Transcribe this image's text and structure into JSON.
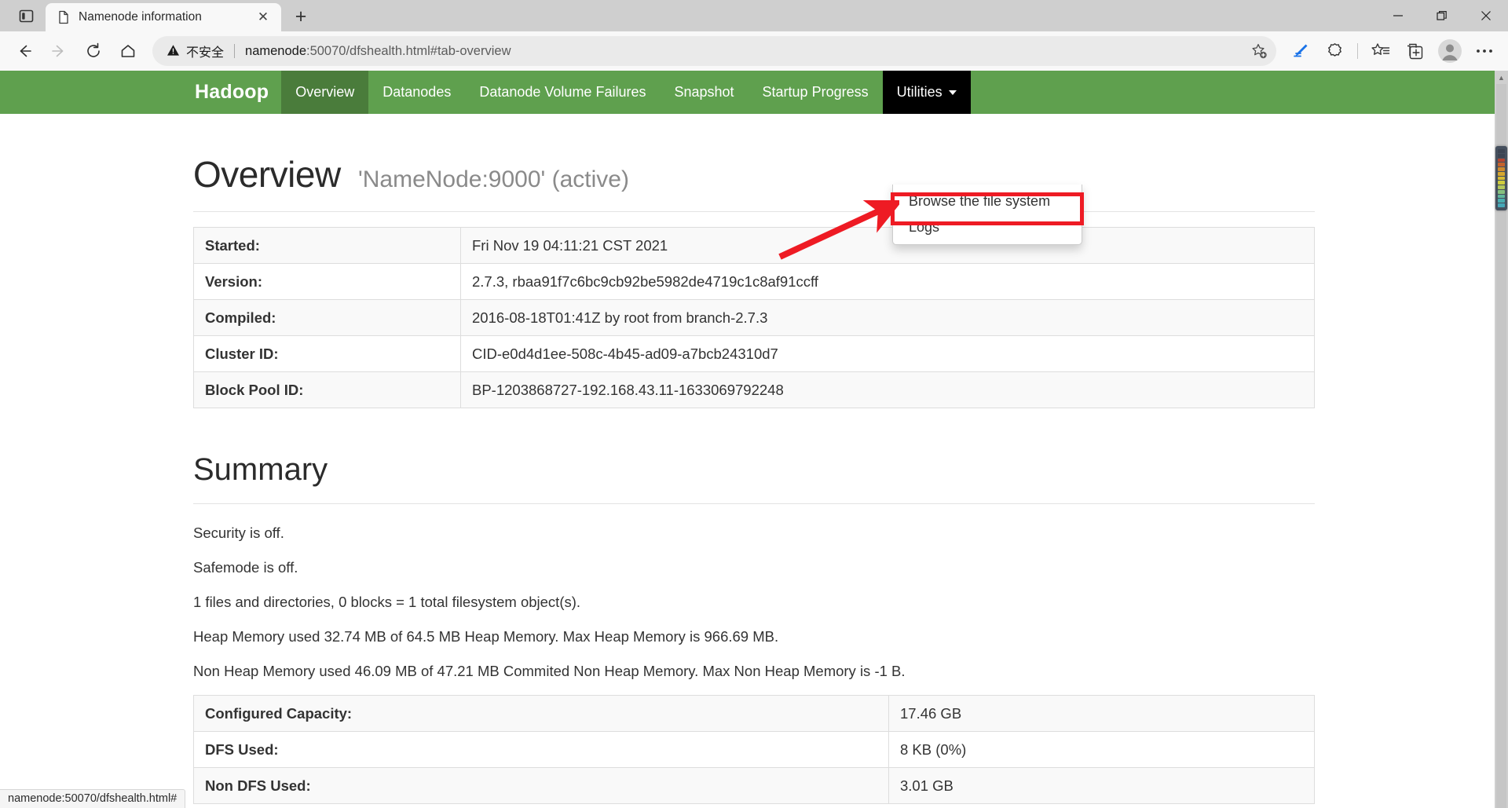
{
  "browser": {
    "tab": {
      "title": "Namenode information",
      "favicon_icon": "document-icon",
      "close_icon": "close-icon"
    },
    "tab_layout_icon": "tab-layout-icon",
    "new_tab_icon": "plus-icon",
    "window_controls": {
      "minimize": "minimize-icon",
      "maximize": "restore-icon",
      "close": "close-icon"
    },
    "nav": {
      "back_icon": "back-arrow-icon",
      "forward_icon": "forward-arrow-icon",
      "reload_icon": "reload-icon",
      "home_icon": "home-icon"
    },
    "omnibox": {
      "warning_icon": "warning-triangle-icon",
      "warning_text": "不安全",
      "url_host": "namenode",
      "url_rest": ":50070/dfshealth.html#tab-overview",
      "url_full": "namenode:50070/dfshealth.html#tab-overview",
      "star_icon": "add-favorite-icon"
    },
    "toolbar_icons": [
      {
        "name": "collections-pen-icon",
        "glyph": "✑"
      },
      {
        "name": "extensions-puzzle-icon",
        "glyph": "✿"
      },
      {
        "name": "favorites-star-list-icon",
        "glyph": "☆"
      },
      {
        "name": "split-screen-add-icon",
        "glyph": "⧉"
      },
      {
        "name": "profile-avatar-icon",
        "glyph": "●"
      },
      {
        "name": "settings-more-icon",
        "glyph": "⋯"
      }
    ]
  },
  "hadoop": {
    "brand": "Hadoop",
    "nav_items": [
      {
        "label": "Overview",
        "state": "active"
      },
      {
        "label": "Datanodes",
        "state": "normal"
      },
      {
        "label": "Datanode Volume Failures",
        "state": "normal"
      },
      {
        "label": "Snapshot",
        "state": "normal"
      },
      {
        "label": "Startup Progress",
        "state": "normal"
      },
      {
        "label": "Utilities",
        "state": "open",
        "caret": true
      }
    ],
    "dropdown": {
      "items": [
        {
          "label": "Browse the file system",
          "highlighted": true
        },
        {
          "label": "Logs",
          "highlighted": false
        }
      ],
      "highlight_color": "#ee1b24"
    },
    "overview": {
      "title": "Overview",
      "subtitle": "'NameNode:9000' (active)",
      "rows": [
        {
          "key": "Started:",
          "value": "Fri Nov 19 04:11:21 CST 2021"
        },
        {
          "key": "Version:",
          "value": "2.7.3, rbaa91f7c6bc9cb92be5982de4719c1c8af91ccff"
        },
        {
          "key": "Compiled:",
          "value": "2016-08-18T01:41Z by root from branch-2.7.3"
        },
        {
          "key": "Cluster ID:",
          "value": "CID-e0d4d1ee-508c-4b45-ad09-a7bcb24310d7"
        },
        {
          "key": "Block Pool ID:",
          "value": "BP-1203868727-192.168.43.11-1633069792248"
        }
      ]
    },
    "summary": {
      "title": "Summary",
      "lines": [
        "Security is off.",
        "Safemode is off.",
        "1 files and directories, 0 blocks = 1 total filesystem object(s).",
        "Heap Memory used 32.74 MB of 64.5 MB Heap Memory. Max Heap Memory is 966.69 MB.",
        "Non Heap Memory used 46.09 MB of 47.21 MB Commited Non Heap Memory. Max Non Heap Memory is -1 B."
      ],
      "rows": [
        {
          "key": "Configured Capacity:",
          "value": "17.46 GB"
        },
        {
          "key": "DFS Used:",
          "value": "8 KB (0%)"
        },
        {
          "key": "Non DFS Used:",
          "value": "3.01 GB"
        }
      ]
    },
    "colors": {
      "navbar_green": "#5fa04e",
      "navbar_active": "#4a7c3b",
      "navbar_open": "#000000"
    }
  },
  "statusbar": {
    "text": "namenode:50070/dfshealth.html#"
  },
  "scrollbar": {
    "up_arrow_icon": "scroll-up-arrow-icon",
    "thumb_segments": [
      "#3c4452",
      "#3c4452",
      "#b5452f",
      "#c4622c",
      "#cf8a2d",
      "#d6a72f",
      "#d8bb33",
      "#cfcc3f",
      "#b4c85a",
      "#86c07e",
      "#5fb79c",
      "#4aaeb0",
      "#46a8b8"
    ]
  }
}
